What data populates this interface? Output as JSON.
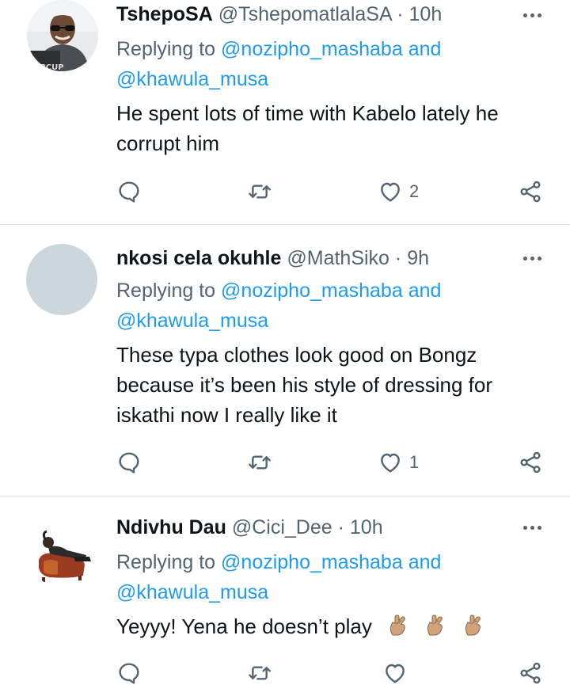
{
  "tweets": [
    {
      "name": "TshepoSA",
      "handle": "@TshepomatlalaSA",
      "separator": "·",
      "time": "10h",
      "replying_prefix": "Replying to",
      "mention1": "@nozipho_mashaba",
      "and": "and",
      "mention2": "@khawula_musa",
      "text_line1": "He spent lots of time with Kabelo lately he",
      "text_line2": "corrupt him",
      "likes": "2",
      "avatar_caption": "RIPCUP"
    },
    {
      "name": "nkosi cela okuhle",
      "handle": "@MathSiko",
      "separator": "·",
      "time": "9h",
      "replying_prefix": "Replying to",
      "mention1": "@nozipho_mashaba",
      "and": "and",
      "mention2": "@khawula_musa",
      "text_line1": "These typa clothes look good on Bongz",
      "text_line2": "because it’s been his style of dressing for",
      "text_line3": "iskathi now I really like it",
      "likes": "1"
    },
    {
      "name": "Ndivhu Dau",
      "handle": "@Cici_Dee",
      "separator": "·",
      "time": "10h",
      "replying_prefix": "Replying to",
      "mention1": "@nozipho_mashaba",
      "and": "and",
      "mention2": "@khawula_musa",
      "text_line1": "Yeyyy! Yena he doesn’t play",
      "likes": ""
    }
  ],
  "icons": {
    "reply": "reply-icon",
    "retweet": "retweet-icon",
    "like": "heart-icon",
    "share": "share-icon",
    "more": "more-options-icon",
    "emoji": "crossed-fingers-emoji"
  },
  "colors": {
    "text_primary": "#0f1419",
    "text_secondary": "#536471",
    "mention": "#1d9bf0",
    "divider": "#e1e6ea"
  }
}
